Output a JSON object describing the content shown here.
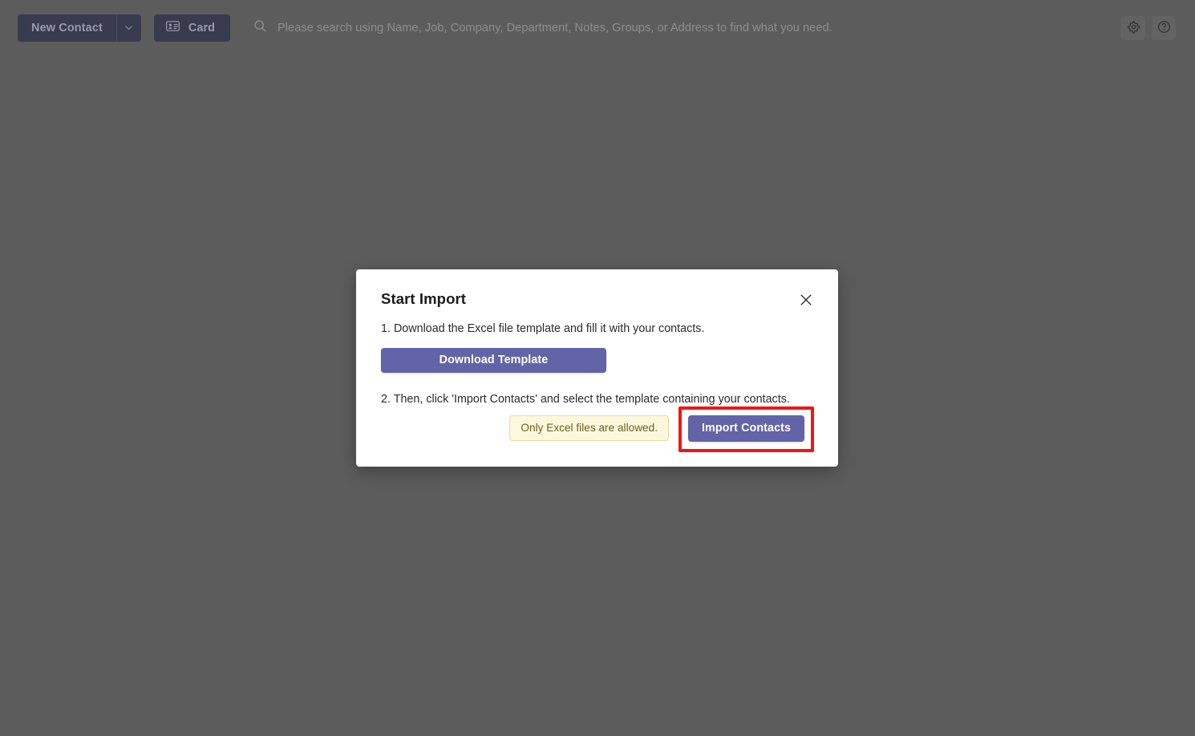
{
  "toolbar": {
    "new_contact_label": "New Contact",
    "new_contact_caret_icon": "chevron-down-icon",
    "card_label": "Card",
    "card_icon": "contact-card-icon",
    "search": {
      "placeholder": "Please search using Name, Job, Company, Department, Notes, Groups, or Address to find what you need.",
      "value": "",
      "icon": "search-icon"
    },
    "settings_icon": "gear-icon",
    "help_icon": "question-circle-icon"
  },
  "modal": {
    "title": "Start Import",
    "close_icon": "close-icon",
    "step1_text": "1. Download the Excel file template and fill it with your contacts.",
    "download_label": "Download Template",
    "step2_text": "2. Then, click 'Import Contacts' and select the template containing your contacts.",
    "tooltip_text": "Only Excel files are allowed.",
    "import_label": "Import Contacts"
  },
  "colors": {
    "backdrop": "#5c5c5c",
    "brand_purple": "#6264a7",
    "toolbar_button": "#383a4e",
    "highlight_red": "#f41414",
    "tooltip_bg": "#fdf8dd",
    "tooltip_border": "#e8dc9a",
    "tooltip_text": "#6a5f1f",
    "modal_bg": "#ffffff"
  }
}
